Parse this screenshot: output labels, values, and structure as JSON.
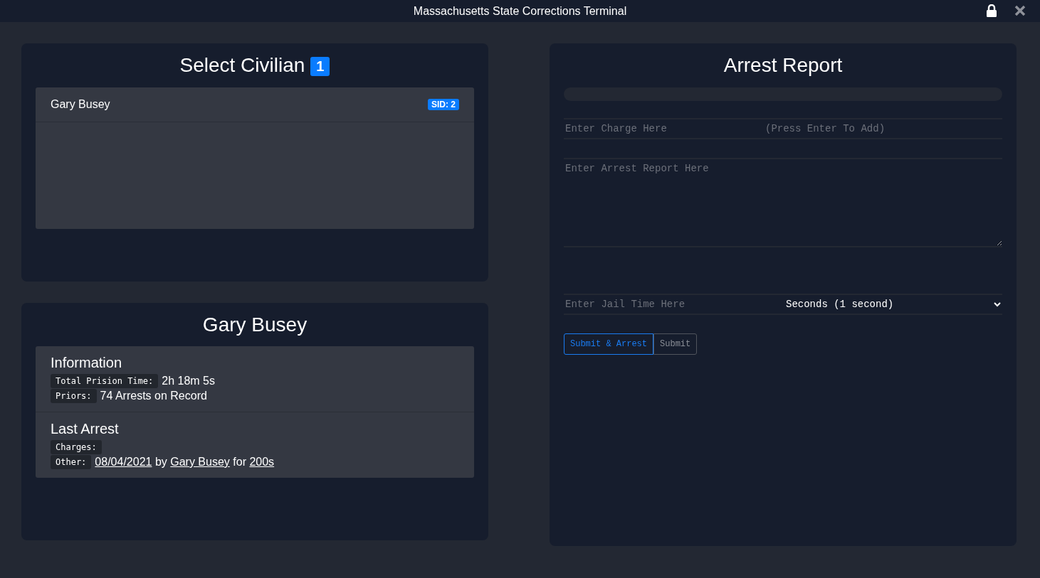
{
  "window": {
    "title": "Massachusetts State Corrections Terminal"
  },
  "civilians": {
    "title": "Select Civilian",
    "count": "1",
    "items": [
      {
        "name": "Gary Busey",
        "sid": "SID: 2",
        "selected": false
      }
    ]
  },
  "profile": {
    "name": "Gary Busey",
    "sections": [
      {
        "title": "Information",
        "rows": [
          {
            "label": "Total Prision Time:",
            "parts": [
              {
                "kind": "text",
                "text": "2h 18m 5s"
              }
            ]
          },
          {
            "label": "Priors:",
            "parts": [
              {
                "kind": "text",
                "text": "74 Arrests on Record"
              }
            ]
          }
        ]
      },
      {
        "title": "Last Arrest",
        "rows": [
          {
            "label": "Charges:",
            "parts": []
          },
          {
            "label": "Other:",
            "parts": [
              {
                "kind": "link",
                "text": "08/04/2021"
              },
              {
                "kind": "text",
                "text": "by"
              },
              {
                "kind": "link",
                "text": "Gary Busey"
              },
              {
                "kind": "text",
                "text": "for"
              },
              {
                "kind": "link",
                "text": "200s"
              }
            ]
          }
        ]
      }
    ]
  },
  "report": {
    "title": "Arrest Report",
    "charge_placeholder": "Enter Charge Here",
    "charge_hint": "(Press Enter To Add)",
    "report_placeholder": "Enter Arrest Report Here",
    "jail_placeholder": "Enter Jail Time Here",
    "unit": "Seconds (1 second)",
    "buttons": [
      {
        "label": "Submit & Arrest",
        "kind": "primary"
      },
      {
        "label": "Submit",
        "kind": "secondary"
      }
    ]
  }
}
